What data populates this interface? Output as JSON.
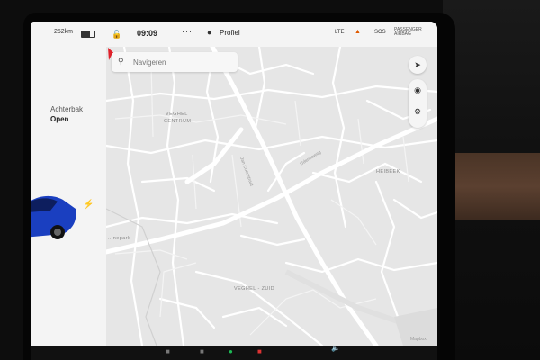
{
  "status_bar": {
    "range": "252km",
    "time": "09:09",
    "profile_label": "Profiel",
    "network": "LTE",
    "sos": "SOS",
    "passenger_airbag": "PASSENGER\nAIRBAG"
  },
  "vehicle": {
    "trunk_label": "Achterbak",
    "trunk_state": "Open"
  },
  "search": {
    "placeholder": "Navigeren"
  },
  "map": {
    "labels": {
      "centrum_1": "VEGHEL",
      "centrum_2": "CENTRUM",
      "zuid": "VEGHEL - ZUID",
      "ceinspark": "...nepark",
      "kleine_label": "HEIBEEK",
      "street_1": "Jan Coenstraat",
      "street_2": "Udenseweg",
      "copyright": "Mapbox"
    }
  },
  "icons": {
    "search": "search-icon",
    "nav": "navigation-icon",
    "pin": "location-pin-icon",
    "settings": "settings-icon",
    "lock": "lock-icon",
    "person": "person-icon",
    "bolt": "charging-bolt-icon",
    "prev": "previous-track-icon",
    "stop": "stop-icon",
    "next": "next-track-icon",
    "star": "favorite-star-icon",
    "volume": "volume-icon"
  },
  "colors": {
    "marker": "#e0202a",
    "car": "#1a3fc0"
  }
}
